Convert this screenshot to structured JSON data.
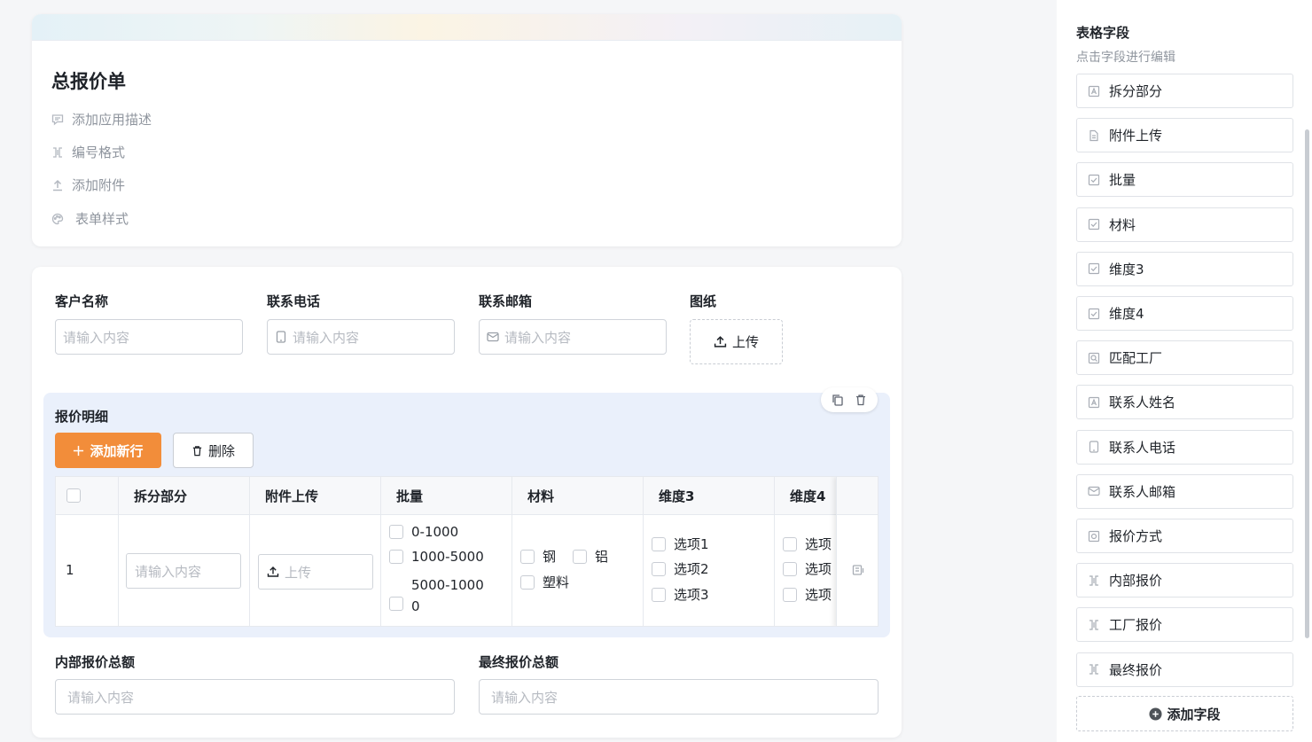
{
  "header": {
    "form_title": "总报价单",
    "meta_items": [
      {
        "label": "添加应用描述",
        "icon": "comment-icon"
      },
      {
        "label": "编号格式",
        "icon": "numbering-icon"
      },
      {
        "label": "添加附件",
        "icon": "upload-icon"
      },
      {
        "label": "表单样式",
        "icon": "palette-icon"
      }
    ]
  },
  "form": {
    "fields": [
      {
        "label": "客户名称",
        "placeholder": "请输入内容"
      },
      {
        "label": "联系电话",
        "placeholder": "请输入内容",
        "icon": "phone-icon"
      },
      {
        "label": "联系邮箱",
        "placeholder": "请输入内容",
        "icon": "mail-icon"
      },
      {
        "label": "图纸",
        "button": "上传"
      }
    ],
    "subtable": {
      "title": "报价明细",
      "add_row": "添加新行",
      "delete": "删除",
      "columns": [
        "拆分部分",
        "附件上传",
        "批量",
        "材料",
        "维度3",
        "维度4"
      ],
      "row": {
        "index": "1",
        "split_placeholder": "请输入内容",
        "upload_label": "上传",
        "batch_options": [
          "0-1000",
          "1000-5000",
          "5000-1000",
          "0"
        ],
        "material_options": [
          "钢",
          "铝",
          "塑料"
        ],
        "dim3_options": [
          "选项1",
          "选项2",
          "选项3"
        ],
        "dim4_options": [
          "选项",
          "选项",
          "选项"
        ]
      }
    },
    "totals": [
      {
        "label": "内部报价总额",
        "placeholder": "请输入内容"
      },
      {
        "label": "最终报价总额",
        "placeholder": "请输入内容"
      }
    ]
  },
  "sidebar": {
    "title": "表格字段",
    "subtitle": "点击字段进行编辑",
    "fields": [
      "拆分部分",
      "附件上传",
      "批量",
      "材料",
      "维度3",
      "维度4",
      "匹配工厂",
      "联系人姓名",
      "联系人电话",
      "联系人邮箱",
      "报价方式",
      "内部报价",
      "工厂报价",
      "最终报价"
    ],
    "add_field": "添加字段"
  },
  "colors": {
    "accent": "#f28d3a",
    "subtable_bg": "#eaf0fb"
  }
}
